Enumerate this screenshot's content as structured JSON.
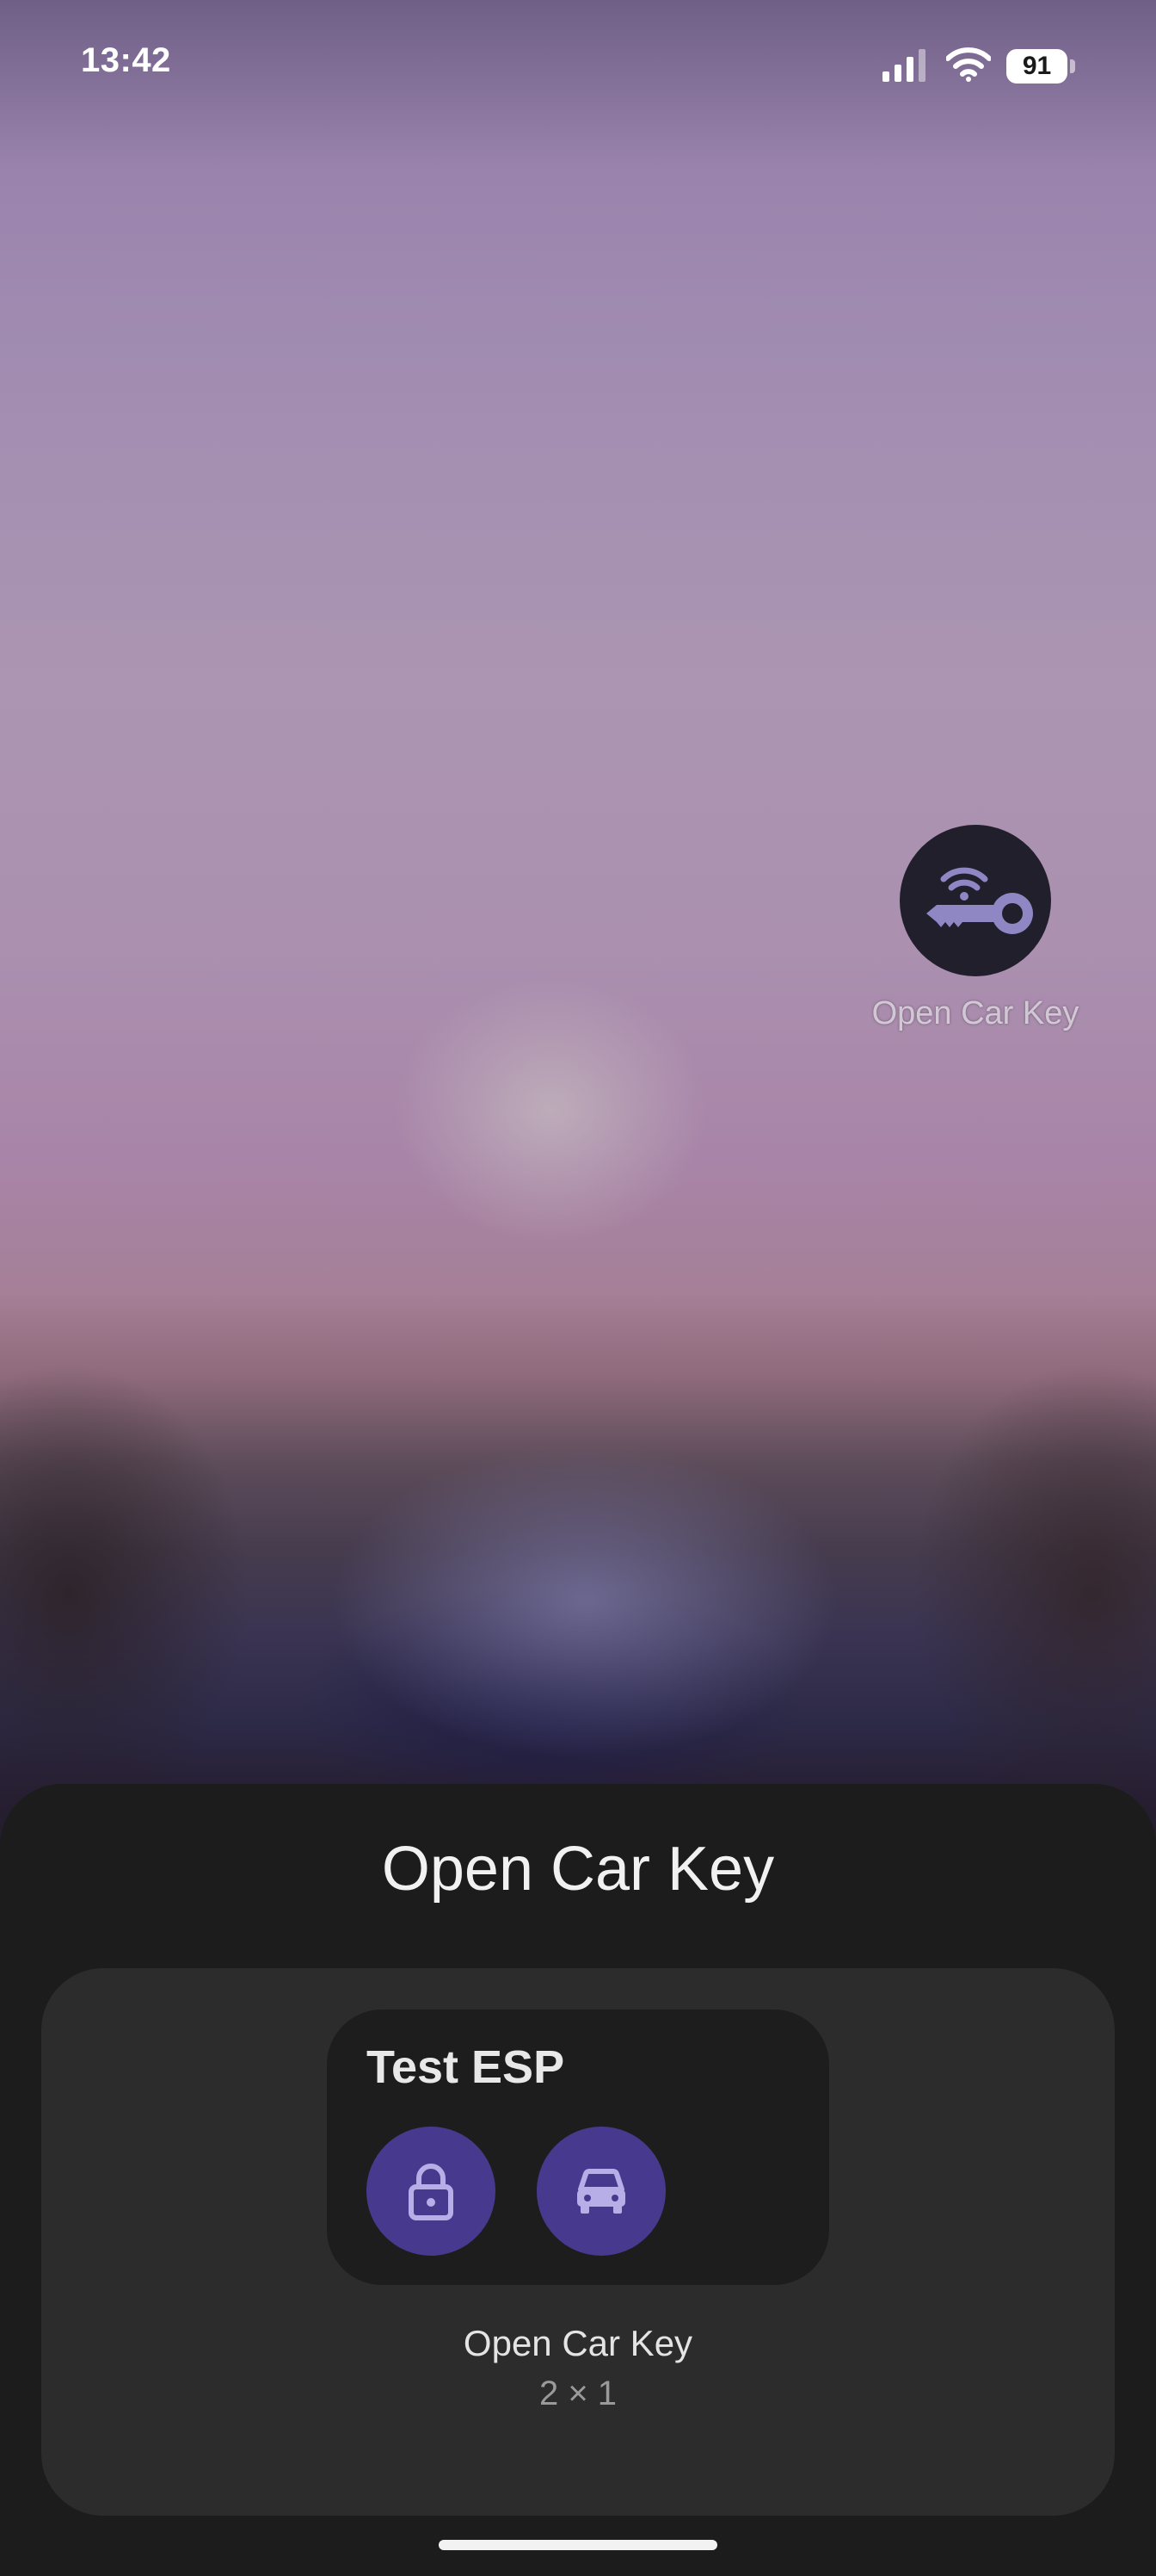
{
  "status_bar": {
    "time": "13:42",
    "battery_level": "91",
    "icons": [
      "signal-icon",
      "wifi-icon",
      "battery-icon"
    ]
  },
  "home_screen": {
    "app_icon": {
      "name": "key-wireless-icon",
      "label": "Open Car Key"
    }
  },
  "widget_picker": {
    "title": "Open Car Key",
    "preview": {
      "widget_title": "Test ESP",
      "buttons": [
        {
          "icon": "lock-icon"
        },
        {
          "icon": "car-icon"
        }
      ]
    },
    "widget_name": "Open Car Key",
    "widget_size": "2 × 1"
  },
  "colors": {
    "sheet_background": "#1c1c1c",
    "card_background": "#2c2c2c",
    "widget_background": "#1d1d1d",
    "accent_button": "#473a8e",
    "accent_icon": "#b7aee8",
    "app_icon_background": "#211f2b",
    "app_icon_glyph": "#8f86c4"
  }
}
